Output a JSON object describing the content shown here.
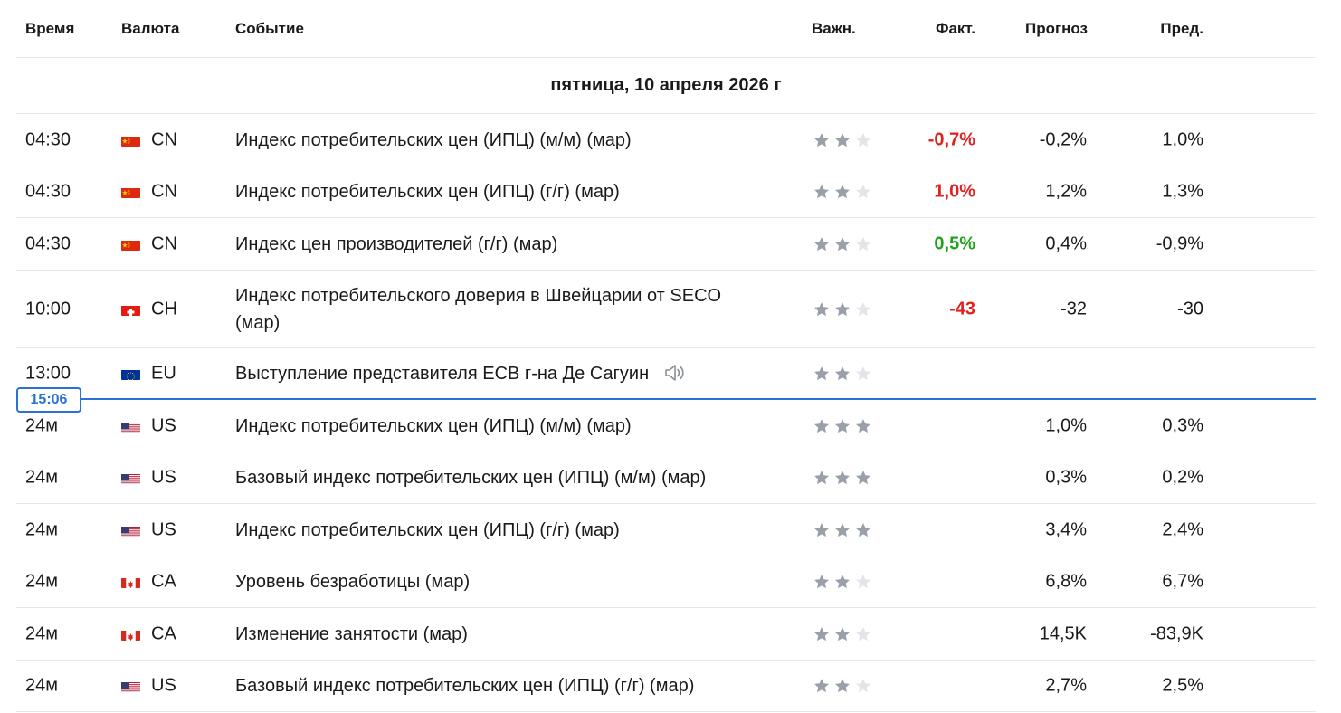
{
  "header": {
    "time": "Время",
    "currency": "Валюта",
    "event": "Событие",
    "importance": "Важн.",
    "actual": "Факт.",
    "forecast": "Прогноз",
    "previous": "Пред."
  },
  "date_label": "пятница, 10 апреля 2026 г",
  "current_time": "15:06",
  "colors": {
    "negative": "#e0211f",
    "positive": "#1fa21a",
    "accent": "#2a72d6",
    "star_on": "#9aa0aa",
    "star_off": "#e2e5ea"
  },
  "rows": [
    {
      "time": "04:30",
      "flag": "cn-flag",
      "currency": "CN",
      "event": "Индекс потребительских цен (ИПЦ) (м/м) (мар)",
      "stars": 2,
      "actual": "-0,7%",
      "actual_tone": "neg",
      "forecast": "-0,2%",
      "previous": "1,0%"
    },
    {
      "time": "04:30",
      "flag": "cn-flag",
      "currency": "CN",
      "event": "Индекс потребительских цен (ИПЦ) (г/г) (мар)",
      "stars": 2,
      "actual": "1,0%",
      "actual_tone": "neg",
      "forecast": "1,2%",
      "previous": "1,3%"
    },
    {
      "time": "04:30",
      "flag": "cn-flag",
      "currency": "CN",
      "event": "Индекс цен производителей (г/г) (мар)",
      "stars": 2,
      "actual": "0,5%",
      "actual_tone": "pos",
      "forecast": "0,4%",
      "previous": "-0,9%"
    },
    {
      "time": "10:00",
      "flag": "ch-flag",
      "currency": "CH",
      "event": "Индекс потребительского доверия в Швейцарии от SECO (мар)",
      "stars": 2,
      "actual": "-43",
      "actual_tone": "neg",
      "forecast": "-32",
      "previous": "-30"
    },
    {
      "time": "13:00",
      "flag": "eu-flag",
      "currency": "EU",
      "event": "Выступление представителя ЕСВ г-на Де Сагуин",
      "stars": 2,
      "actual": "",
      "actual_tone": "",
      "forecast": "",
      "previous": "",
      "speech": true
    },
    {
      "time": "24м",
      "flag": "us-flag",
      "currency": "US",
      "event": "Индекс потребительских цен (ИПЦ) (м/м) (мар)",
      "stars": 3,
      "actual": "",
      "actual_tone": "",
      "forecast": "1,0%",
      "previous": "0,3%"
    },
    {
      "time": "24м",
      "flag": "us-flag",
      "currency": "US",
      "event": "Базовый индекс потребительских цен (ИПЦ) (м/м) (мар)",
      "stars": 3,
      "actual": "",
      "actual_tone": "",
      "forecast": "0,3%",
      "previous": "0,2%"
    },
    {
      "time": "24м",
      "flag": "us-flag",
      "currency": "US",
      "event": "Индекс потребительских цен (ИПЦ) (г/г) (мар)",
      "stars": 3,
      "actual": "",
      "actual_tone": "",
      "forecast": "3,4%",
      "previous": "2,4%"
    },
    {
      "time": "24м",
      "flag": "ca-flag",
      "currency": "CA",
      "event": "Уровень безработицы (мар)",
      "stars": 2,
      "actual": "",
      "actual_tone": "",
      "forecast": "6,8%",
      "previous": "6,7%"
    },
    {
      "time": "24м",
      "flag": "ca-flag",
      "currency": "CA",
      "event": "Изменение занятости (мар)",
      "stars": 2,
      "actual": "",
      "actual_tone": "",
      "forecast": "14,5K",
      "previous": "-83,9K"
    },
    {
      "time": "24м",
      "flag": "us-flag",
      "currency": "US",
      "event": "Базовый индекс потребительских цен (ИПЦ) (г/г) (мар)",
      "stars": 2,
      "actual": "",
      "actual_tone": "",
      "forecast": "2,7%",
      "previous": "2,5%"
    }
  ]
}
